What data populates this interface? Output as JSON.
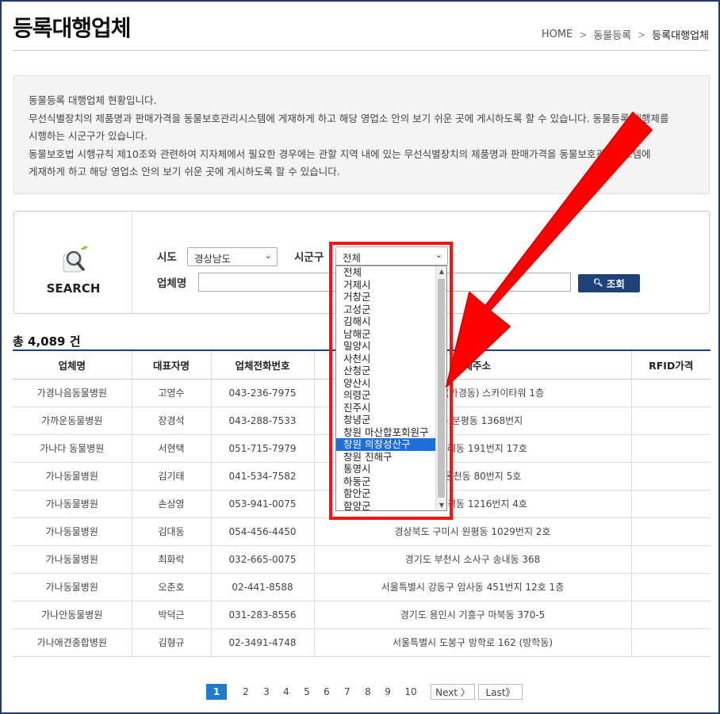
{
  "header": {
    "title": "등록대행업체",
    "breadcrumb": {
      "home": "HOME",
      "sep1": ">",
      "level1": "동물등록",
      "sep2": ">",
      "current": "등록대행업체"
    }
  },
  "info": {
    "lines": [
      "동물등록 대행업체 현황입니다.",
      "무선식별장치의 제품명과 판매가격을 동물보호관리시스템에 게재하게 하고 해당 영업소 안의 보기 쉬운 곳에 게시하도록 할 수 있습니다. 동물등록 대행제를",
      "시행하는 시군구가 있습니다.",
      "동물보호법 시행규칙 제10조와 관련하여 지자체에서 필요한 경우에는 관할 지역 내에 있는 무선식별장치의 제품명과 판매가격을 동물보호관리시스템에",
      "게재하게 하고 해당 영업소 안의 보기 쉬운 곳에 게시하도록 할 수 있습니다."
    ]
  },
  "search": {
    "caption": "SEARCH",
    "sido_label": "시도",
    "sido_value": "경상남도",
    "sigungu_label": "시군구",
    "sigungu_value": "전체",
    "name_label": "업체명",
    "name_value": "",
    "button_label": "조회",
    "search_glyph": "🔍︎",
    "chevron": "⌄"
  },
  "dropdown": {
    "options": [
      "전체",
      "거제시",
      "거창군",
      "고성군",
      "김해시",
      "남해군",
      "밀양시",
      "사천시",
      "산청군",
      "양산시",
      "의령군",
      "진주시",
      "창녕군",
      "창원 마산합포회원구",
      "창원 의창성산구",
      "창원 진해구",
      "통영시",
      "하동군",
      "함안군",
      "함양군"
    ],
    "selected": "창원 의창성산구",
    "scroll_up": "▲",
    "scroll_down": "▼"
  },
  "results": {
    "total": "총 4,089 건",
    "columns": [
      "업체명",
      "대표자명",
      "업체전화번호",
      "업체주소",
      "RFID가격"
    ],
    "rows": [
      [
        "가경나음동물병원",
        "고영수",
        "043-236-7975",
        "서현로 90 (가경동) 스카이타워 1층",
        ""
      ],
      [
        "가까운동물병원",
        "장경석",
        "043-288-7533",
        "흥덕구 분평동 1368번지",
        ""
      ],
      [
        "가나다 동물병원",
        "서현택",
        "051-715-7979",
        "장구 주례동 191번지 17호",
        ""
      ],
      [
        "가나동물병원",
        "김기태",
        "041-534-7582",
        "산시 온천동 80번지 5호",
        ""
      ],
      [
        "가나동물병원",
        "손상영",
        "053-941-0075",
        "동구 산격동 1216번지 4호",
        ""
      ],
      [
        "가나동물병원",
        "김대동",
        "054-456-4450",
        "경상북도 구미시 원평동 1029번지 2호",
        ""
      ],
      [
        "가나동물병원",
        "최화락",
        "032-665-0075",
        "경기도 부천시 소사구 송내동 368",
        ""
      ],
      [
        "가나동물병원",
        "오춘호",
        "02-441-8588",
        "서울특별시 강동구 암사동 451번지 12호 1층",
        ""
      ],
      [
        "가나안동물병원",
        "박덕근",
        "031-283-8556",
        "경기도 용인시 기흥구 마북동 370-5",
        ""
      ],
      [
        "가나애견종합병원",
        "김형규",
        "02-3491-4748",
        "서울특별시 도봉구 방학로 162 (방학동)",
        ""
      ]
    ]
  },
  "pagination": {
    "pages": [
      "1",
      "2",
      "3",
      "4",
      "5",
      "6",
      "7",
      "8",
      "9",
      "10"
    ],
    "current": "1",
    "next": "Next 〉",
    "last": "Last》"
  },
  "annotation": {
    "box_color": "#ff1010",
    "arrow_color": "#ff0000"
  }
}
